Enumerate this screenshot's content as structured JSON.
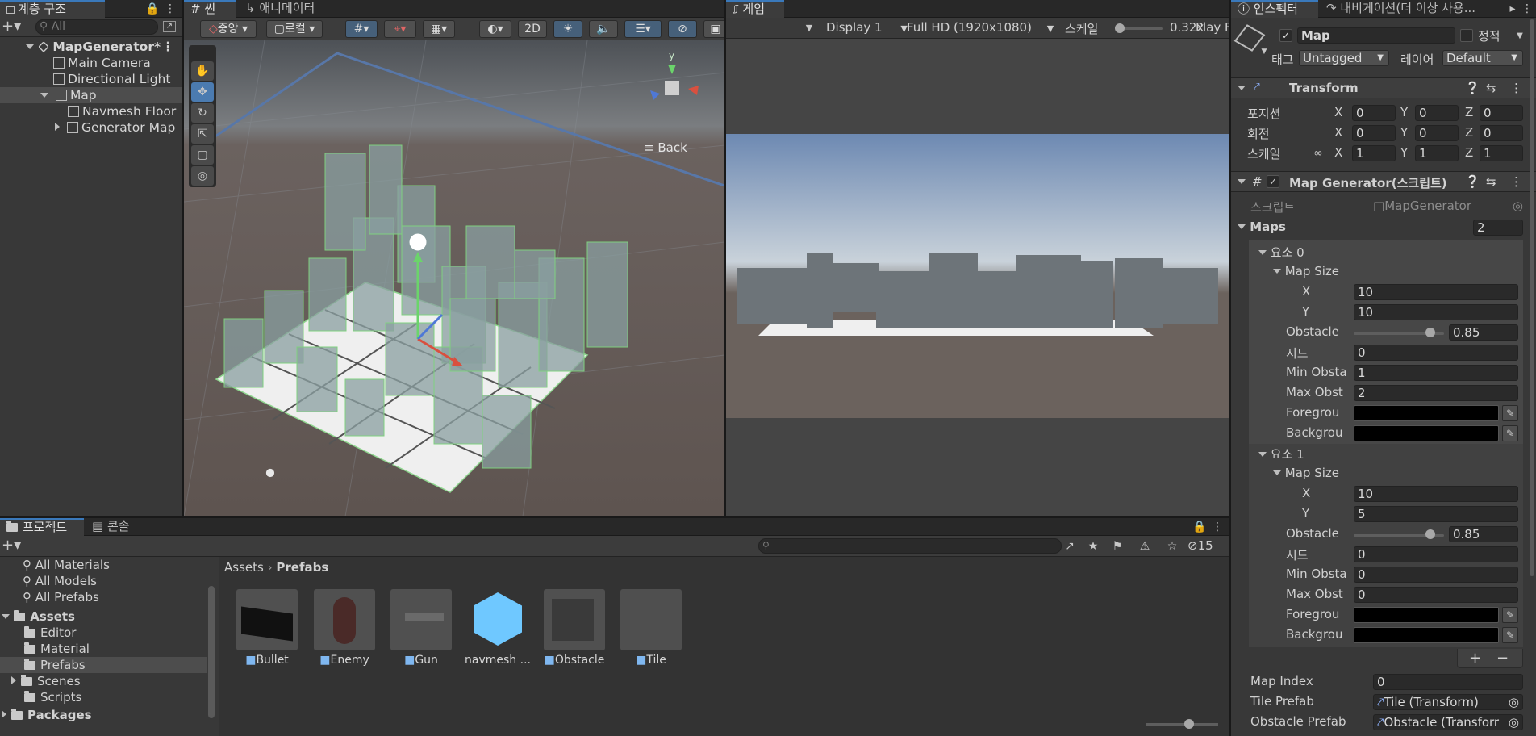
{
  "hierarchy": {
    "tab": "계층 구조",
    "search_placeholder": "All",
    "scene": "MapGenerator*",
    "items": [
      "Main Camera",
      "Directional Light",
      "Map",
      "Navmesh Floor",
      "Generator Map"
    ]
  },
  "scene_view": {
    "tabs": [
      "씬",
      "애니메이터"
    ],
    "pivot": "중앙",
    "space": "로컬",
    "mode_2d": "2D",
    "gizmo_back": "Back",
    "gizmo_axis_y": "y"
  },
  "game_view": {
    "tab": "게임",
    "display": "Display 1",
    "resolution": "Full HD (1920x1080)",
    "scale_label": "스케일",
    "scale_value": "0.32x",
    "play_label": "Play F"
  },
  "inspector": {
    "tabs": [
      "인스펙터",
      "내비게이션(더 이상 사용..."
    ],
    "object_name": "Map",
    "static_label": "정적",
    "tag_label": "태그",
    "tag_value": "Untagged",
    "layer_label": "레이어",
    "layer_value": "Default",
    "transform": {
      "title": "Transform",
      "rows": [
        {
          "label": "포지션",
          "x": "0",
          "y": "0",
          "z": "0"
        },
        {
          "label": "회전",
          "x": "0",
          "y": "0",
          "z": "0"
        },
        {
          "label": "스케일",
          "x": "1",
          "y": "1",
          "z": "1"
        }
      ],
      "axes": [
        "X",
        "Y",
        "Z"
      ]
    },
    "script_component": {
      "title": "Map Generator(스크립트)",
      "script_label": "스크립트",
      "script_value": "MapGenerator",
      "maps_label": "Maps",
      "maps_count": "2",
      "elements": [
        {
          "label": "요소 0",
          "map_size_label": "Map Size",
          "x_label": "X",
          "x": "10",
          "y_label": "Y",
          "y": "10",
          "obstacle_label": "Obstacle",
          "obstacle": "0.85",
          "obstacle_fraction": 0.85,
          "seed_label": "시드",
          "seed": "0",
          "min_label": "Min Obsta",
          "min": "1",
          "max_label": "Max Obst",
          "max": "2",
          "fore_label": "Foregrou",
          "back_label": "Backgrou"
        },
        {
          "label": "요소 1",
          "map_size_label": "Map Size",
          "x_label": "X",
          "x": "10",
          "y_label": "Y",
          "y": "5",
          "obstacle_label": "Obstacle",
          "obstacle": "0.85",
          "obstacle_fraction": 0.85,
          "seed_label": "시드",
          "seed": "0",
          "min_label": "Min Obsta",
          "min": "0",
          "max_label": "Max Obst",
          "max": "0",
          "fore_label": "Foregrou",
          "back_label": "Backgrou"
        }
      ],
      "map_index_label": "Map Index",
      "map_index": "0",
      "tile_prefab_label": "Tile Prefab",
      "tile_prefab": "Tile (Transform)",
      "obstacle_prefab_label": "Obstacle Prefab",
      "obstacle_prefab": "Obstacle (Transforr"
    }
  },
  "project": {
    "tabs": [
      "프로젝트",
      "콘솔"
    ],
    "hidden_count": "15",
    "tree": [
      "All Materials",
      "All Models",
      "All Prefabs",
      "Assets",
      "Editor",
      "Material",
      "Prefabs",
      "Scenes",
      "Scripts",
      "Packages"
    ],
    "breadcrumb": [
      "Assets",
      "Prefabs"
    ],
    "assets": [
      "Bullet",
      "Enemy",
      "Gun",
      "navmesh ...",
      "Obstacle",
      "Tile"
    ]
  },
  "colors": {
    "accent": "#3a79bb",
    "selection": "#2c5d87",
    "panel": "#383838"
  }
}
